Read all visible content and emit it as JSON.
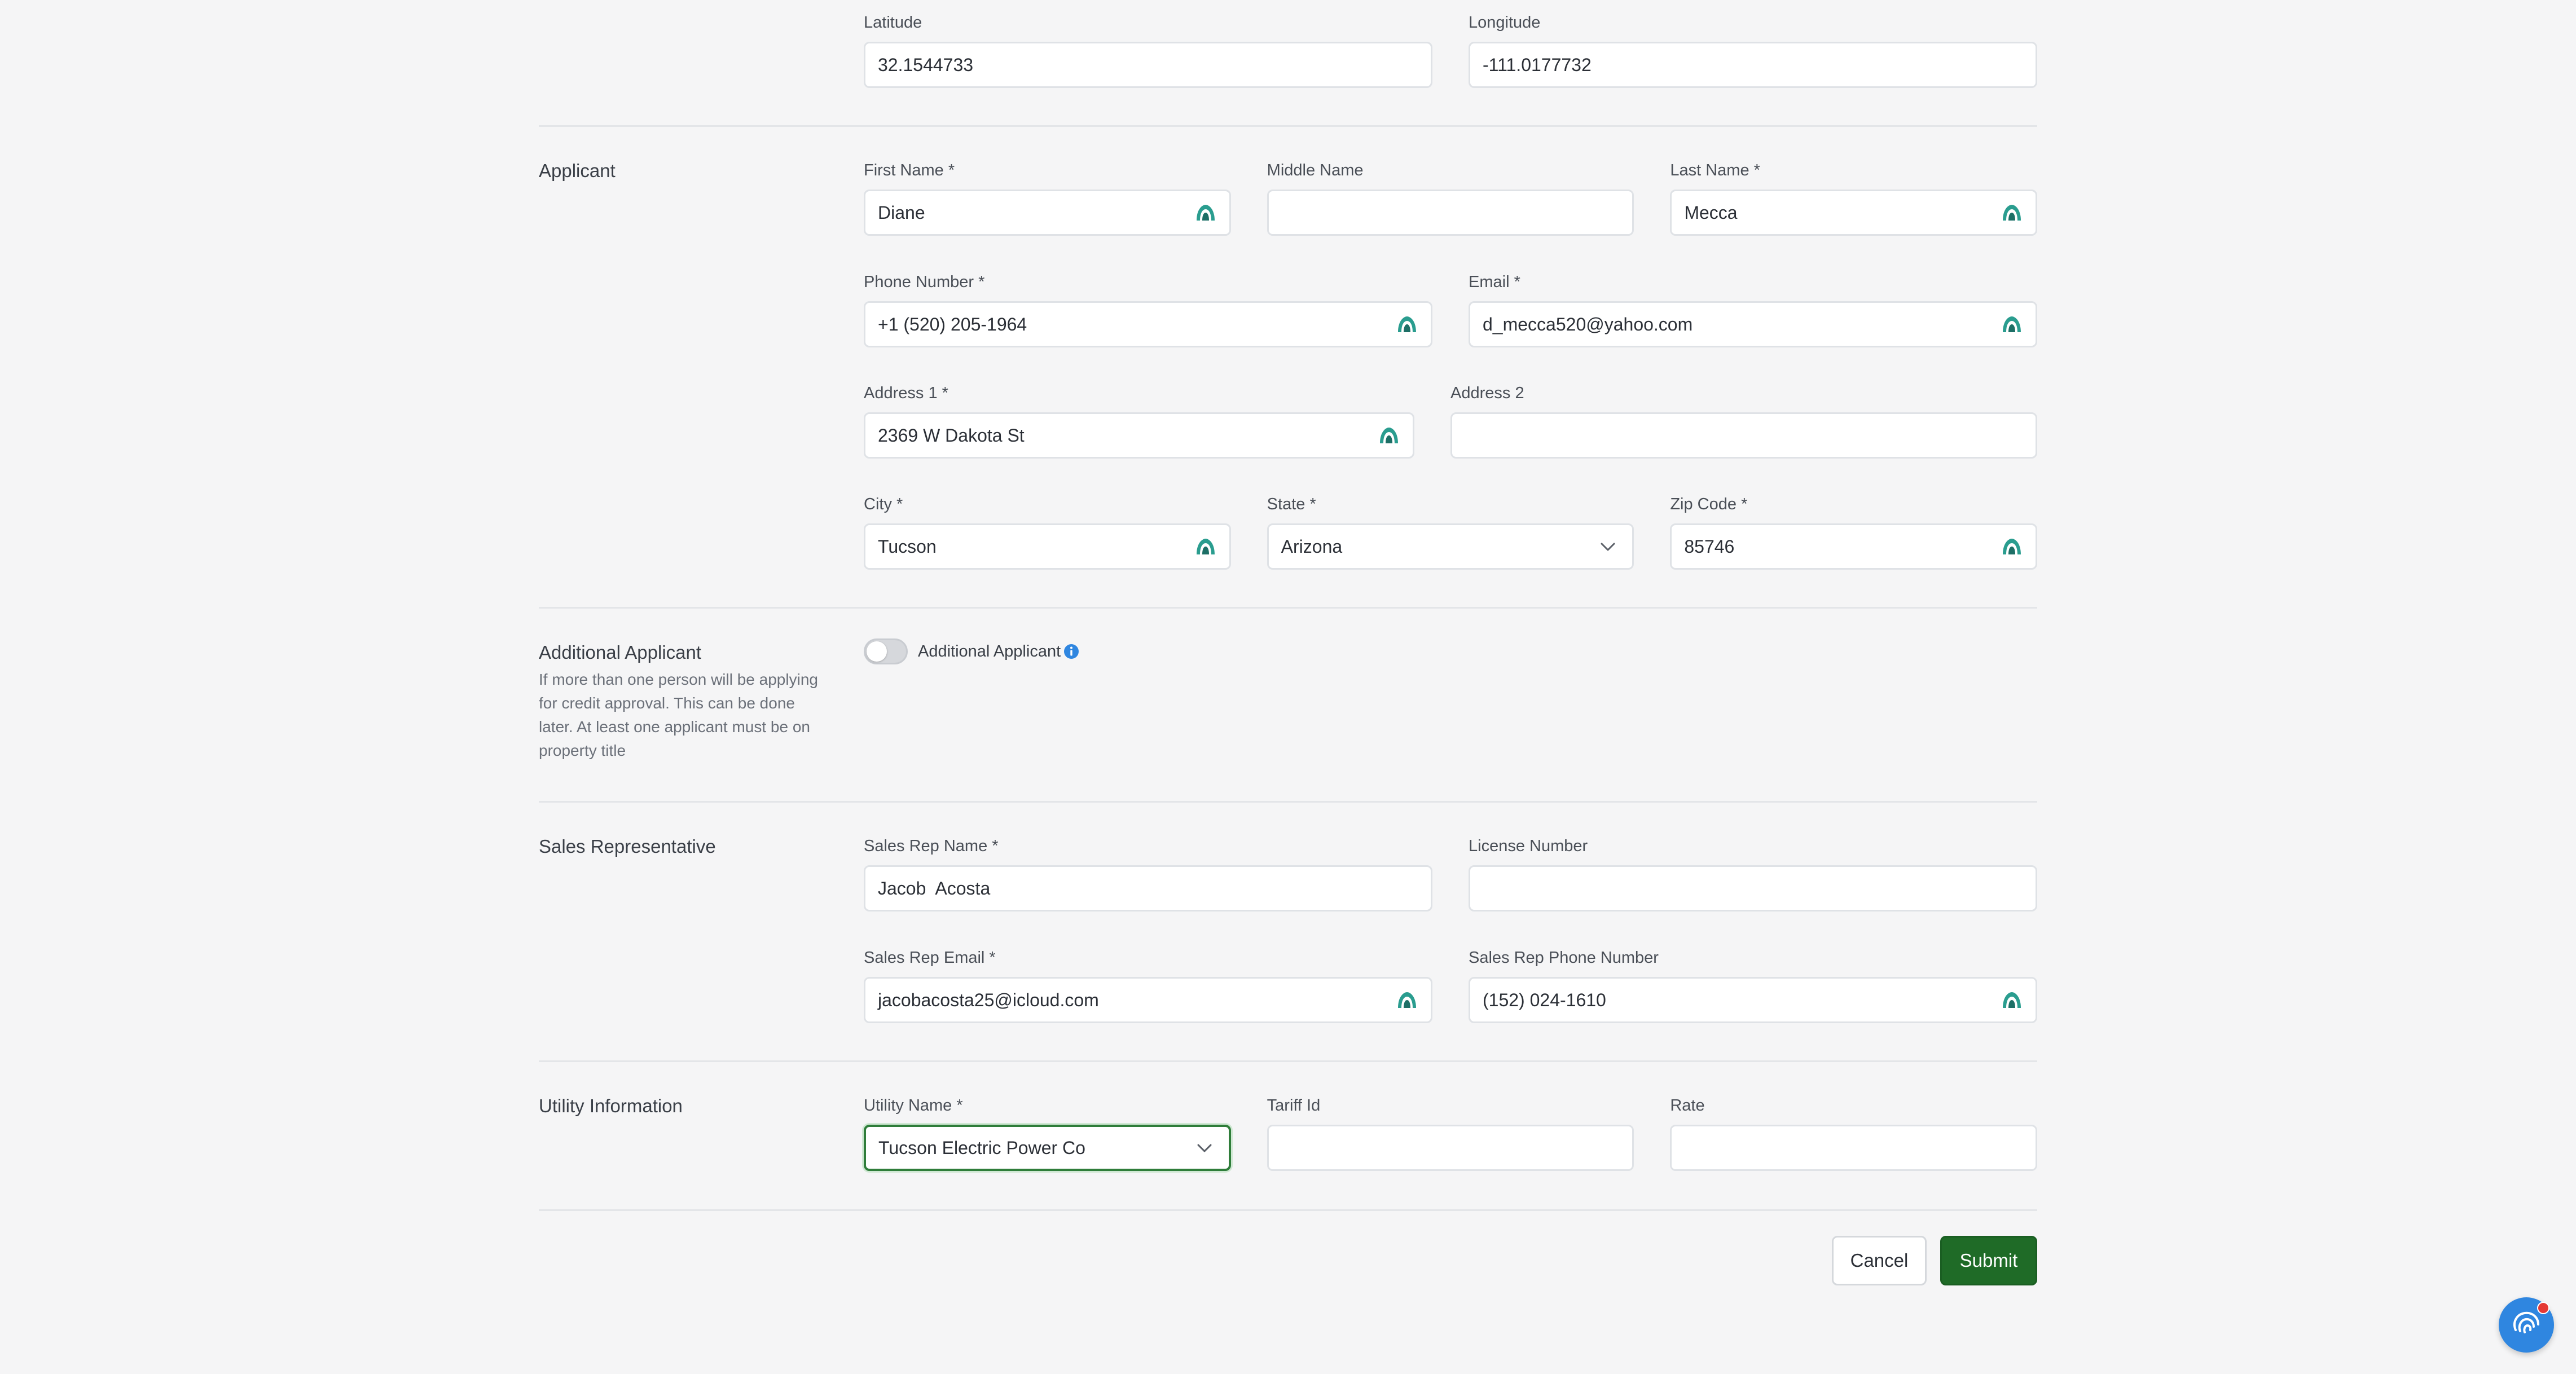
{
  "location": {
    "latitude_label": "Latitude",
    "latitude_value": "32.1544733",
    "longitude_label": "Longitude",
    "longitude_value": "-111.0177732"
  },
  "applicant": {
    "title": "Applicant",
    "first_name_label": "First Name *",
    "first_name_value": "Diane",
    "middle_name_label": "Middle Name",
    "middle_name_value": "",
    "last_name_label": "Last Name *",
    "last_name_value": "Mecca",
    "phone_label": "Phone Number *",
    "phone_value": "+1 (520) 205-1964",
    "email_label": "Email *",
    "email_value": "d_mecca520@yahoo.com",
    "address1_label": "Address 1 *",
    "address1_value": "2369 W Dakota St",
    "address2_label": "Address 2",
    "address2_value": "",
    "city_label": "City *",
    "city_value": "Tucson",
    "state_label": "State *",
    "state_value": "Arizona",
    "zip_label": "Zip Code *",
    "zip_value": "85746"
  },
  "additional_applicant": {
    "title": "Additional Applicant",
    "description": "If more than one person will be applying for credit approval. This can be done later. At least one applicant must be on property title",
    "toggle_label": "Additional Applicant",
    "toggle_on": false
  },
  "sales_rep": {
    "title": "Sales Representative",
    "name_label": "Sales Rep Name *",
    "name_value": "Jacob  Acosta",
    "license_label": "License Number",
    "license_value": "",
    "email_label": "Sales Rep Email *",
    "email_value": "jacobacosta25@icloud.com",
    "phone_label": "Sales Rep Phone Number",
    "phone_value": "(152) 024-1610"
  },
  "utility": {
    "title": "Utility Information",
    "name_label": "Utility Name *",
    "name_value": "Tucson Electric Power Co",
    "tariff_label": "Tariff Id",
    "tariff_value": "",
    "rate_label": "Rate",
    "rate_value": ""
  },
  "actions": {
    "cancel_label": "Cancel",
    "submit_label": "Submit"
  },
  "icons": {
    "autofill": "autofill-icon",
    "dropdown": "chevron-down-icon",
    "info": "info-icon",
    "chat": "chat-support-icon"
  },
  "colors": {
    "autofill_icon": "#2a9d8f",
    "submit_bg": "#1f6b27",
    "focus_border": "#2f7d3a",
    "info_blue": "#2f86e0",
    "chat_bg": "#2f86e0",
    "notification_dot": "#e53935"
  }
}
